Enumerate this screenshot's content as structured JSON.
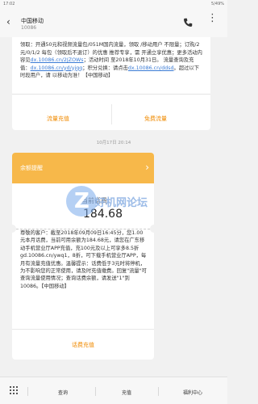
{
  "status": {
    "time": "17:02",
    "right": "5/49%"
  },
  "header": {
    "title": "中国移动",
    "subtitle": "10086"
  },
  "message1": {
    "text_a": "领取：开通50元和视频流量包/051M国内流量，领取 /移动用户 不限量；订购/2元/0/1/2 每包（领取后不退订）的优惠 推荐专享，需 开通立享优惠；更多活动内容见",
    "link1": "dx.10086.cn/2JZOWs",
    "text_b": "；活动时间 至2018年10月31日。 流量查询及充值：",
    "link2": "dx.10086.cn/yd/yjqq",
    "text_c": "；积分兑换：请点击",
    "link3": "dx.10086.cn/ddsd",
    "text_d": "。超过以下时段用户，请 以移动为准！【中国移动】",
    "btn_left": "流量充值",
    "btn_right": "免费流量"
  },
  "timestamp": "10月17日 20:14",
  "card": {
    "header_title": "余额提醒",
    "remain_label": "当前话费",
    "remain_value": "184.68",
    "body_text": "尊敬的客户：截至2018年09月09日16:45分，您1.00元本月话费，当前可用余额为184.68元，请您在广东移动手机营业厅APP充值，充100元及以上可享多8.5折 gd.10086.cn/ywq1，8折，可下载手机营业厅APP，每月有流量充值优惠。温馨提示：话费低于3元时将停机，为不影响您的正常使用，请及时充值缴费。回复\"流量\"可查询流量使用情况；查询话费余额，请发送\"1\"到10086。【中国移动】",
    "footer_btn": "话费充值"
  },
  "watermark": {
    "logo_letter": "Z",
    "text": "好机网论坛"
  },
  "bottom": {
    "tab1": "查询",
    "tab2": "充值",
    "tab3": "福利中心"
  }
}
